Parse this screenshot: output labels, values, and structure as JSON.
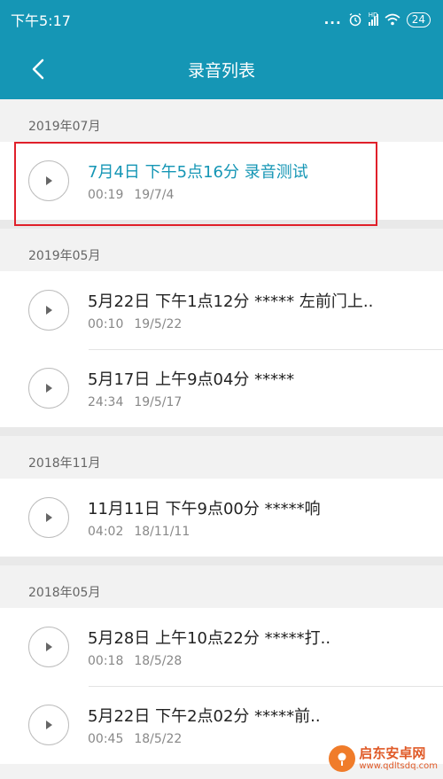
{
  "status_bar": {
    "time": "下午5:17",
    "dots": "...",
    "signal_label": "HD",
    "battery": "24",
    "icons": [
      "alarm-icon",
      "signal-icon",
      "wifi-icon",
      "battery-icon"
    ]
  },
  "header": {
    "title": "录音列表",
    "back_icon": "chevron-left-icon"
  },
  "colors": {
    "accent": "#1596b5",
    "highlight_border": "#e0202a",
    "watermark": "#e05a28"
  },
  "sections": [
    {
      "label": "2019年07月",
      "recordings": [
        {
          "title": "7月4日 下午5点16分 录音测试",
          "duration": "00:19",
          "date": "19/7/4",
          "highlighted": true
        }
      ]
    },
    {
      "label": "2019年05月",
      "recordings": [
        {
          "title": "5月22日 下午1点12分 ***** 左前门上..",
          "duration": "00:10",
          "date": "19/5/22"
        },
        {
          "title": "5月17日 上午9点04分 *****",
          "duration": "24:34",
          "date": "19/5/17"
        }
      ]
    },
    {
      "label": "2018年11月",
      "recordings": [
        {
          "title": "11月11日 下午9点00分 *****响",
          "duration": "04:02",
          "date": "18/11/11"
        }
      ]
    },
    {
      "label": "2018年05月",
      "recordings": [
        {
          "title": "5月28日 上午10点22分 *****打..",
          "duration": "00:18",
          "date": "18/5/28"
        },
        {
          "title": "5月22日 下午2点02分 *****前..",
          "duration": "00:45",
          "date": "18/5/22"
        }
      ]
    }
  ],
  "watermark": {
    "name": "启东安卓网",
    "url": "www.qdltsdq.com"
  }
}
